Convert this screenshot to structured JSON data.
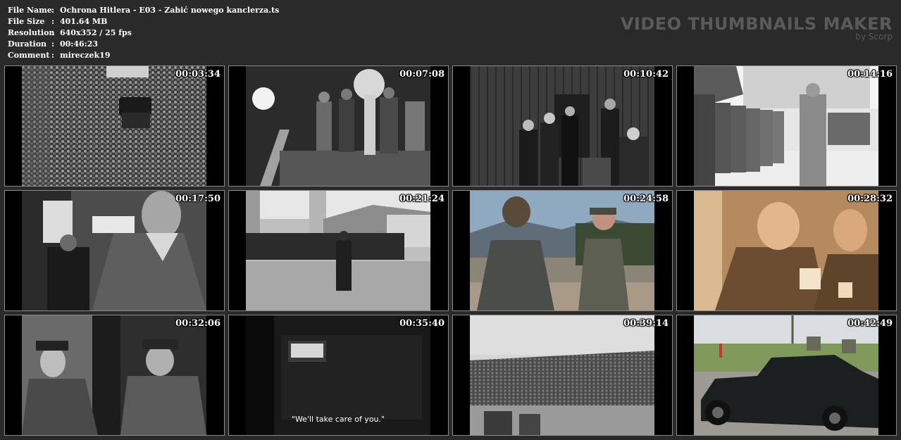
{
  "file_info": [
    {
      "label": "File Name",
      "sep": ":",
      "value": "Ochrona Hitlera - E03 - Zabić nowego kanclerza.ts"
    },
    {
      "label": "File Size",
      "sep": ":",
      "value": "401.64 MB"
    },
    {
      "label": "Resolution",
      "sep": ":",
      "value": "640x352 / 25 fps"
    },
    {
      "label": "Duration",
      "sep": ":",
      "value": "00:46:23"
    },
    {
      "label": "Comment",
      "sep": ":",
      "value": "mireczek19"
    }
  ],
  "brand": {
    "title": "VIDEO THUMBNAILS MAKER",
    "subtitle": "by Scorp"
  },
  "thumbnails": [
    {
      "timestamp": "00:03:34",
      "scene": "crowd",
      "tone": "bw"
    },
    {
      "timestamp": "00:07:08",
      "scene": "procession",
      "tone": "bw"
    },
    {
      "timestamp": "00:10:42",
      "scene": "doorway-group",
      "tone": "bw"
    },
    {
      "timestamp": "00:14:16",
      "scene": "soldiers-line",
      "tone": "bw"
    },
    {
      "timestamp": "00:17:50",
      "scene": "man-portrait",
      "tone": "bw"
    },
    {
      "timestamp": "00:21:24",
      "scene": "parade-square",
      "tone": "bw"
    },
    {
      "timestamp": "00:24:58",
      "scene": "terrace-color",
      "tone": "color"
    },
    {
      "timestamp": "00:28:32",
      "scene": "toast-sepia",
      "tone": "sepia"
    },
    {
      "timestamp": "00:32:06",
      "scene": "two-officers",
      "tone": "bw"
    },
    {
      "timestamp": "00:35:40",
      "scene": "dark-window",
      "tone": "bw",
      "subtitle": "\"We'll take care of you.\""
    },
    {
      "timestamp": "00:39:14",
      "scene": "field-crowd",
      "tone": "bw"
    },
    {
      "timestamp": "00:42:49",
      "scene": "car-color",
      "tone": "color"
    }
  ]
}
